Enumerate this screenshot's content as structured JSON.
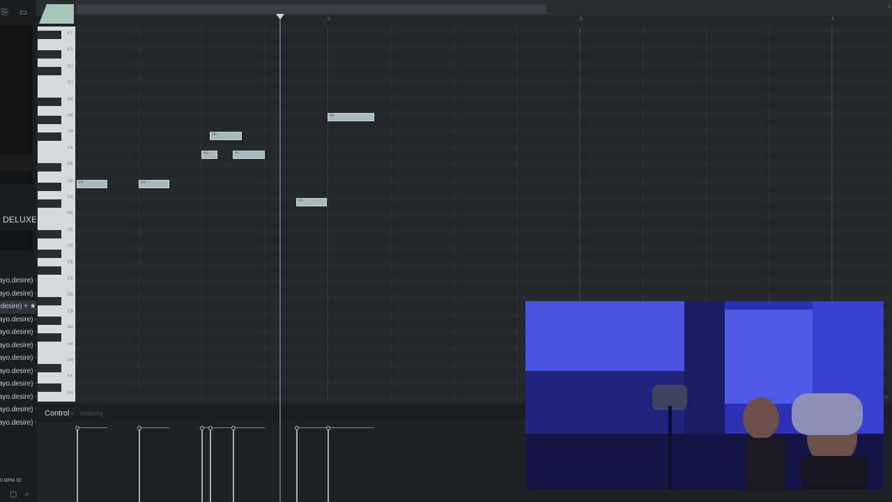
{
  "browser": {
    "deluxe_label": "DELUXE",
    "plugins": [
      {
        "label": "ayo.desire) +",
        "selected": false
      },
      {
        "label": "ayo.desire) +",
        "selected": false
      },
      {
        "label": ".desire) + ★",
        "selected": true
      },
      {
        "label": "ayo.desire) +",
        "selected": false
      },
      {
        "label": "ayo.desire) +",
        "selected": false
      },
      {
        "label": "ayo.desire) +",
        "selected": false
      },
      {
        "label": "ayo.desire) +",
        "selected": false
      },
      {
        "label": "ayo.desire) +",
        "selected": false
      },
      {
        "label": "ayo.desire) +",
        "selected": false
      },
      {
        "label": "ayo.desire) +",
        "selected": false
      },
      {
        "label": "ayo.desire) +",
        "selected": false
      },
      {
        "label": "ayo.desire) +",
        "selected": false
      }
    ],
    "bpm_text": "0 BPM 32"
  },
  "ruler": {
    "bars": [
      "2",
      "3",
      "4"
    ]
  },
  "keyboard": {
    "labels": [
      "F7",
      "E7",
      "D7",
      "C7",
      "B6",
      "A6",
      "G6",
      "F6",
      "E6",
      "D6",
      "C6",
      "B5",
      "A5",
      "G5",
      "F5",
      "E5",
      "D5",
      "C5",
      "B4",
      "A4",
      "G4",
      "F4",
      "E4"
    ]
  },
  "notes": [
    {
      "label": "D6"
    },
    {
      "label": "D6"
    },
    {
      "label": "F6"
    },
    {
      "label": "G6"
    },
    {
      "label": "F6"
    },
    {
      "label": "C6"
    },
    {
      "label": "A6"
    }
  ],
  "control": {
    "label": "Control",
    "parameter": "Velocity"
  },
  "icons": {
    "browser": "browser-icon",
    "folder": "folder-icon",
    "search": "search-icon",
    "playhead": "playhead-marker-icon"
  },
  "colors": {
    "note": "#a8b9be",
    "grid": "#24292d",
    "accent": "#a8c7b9",
    "webcam_light": "#3a3fd0"
  }
}
